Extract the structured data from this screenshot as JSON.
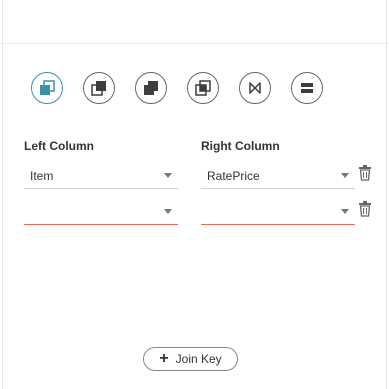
{
  "joinTypes": [
    {
      "name": "left-join",
      "active": true
    },
    {
      "name": "right-join",
      "active": false
    },
    {
      "name": "inner-join",
      "active": false
    },
    {
      "name": "full-join",
      "active": false
    },
    {
      "name": "bowtie-join",
      "active": false
    },
    {
      "name": "union",
      "active": false
    }
  ],
  "headers": {
    "left": "Left Column",
    "right": "Right Column"
  },
  "rows": [
    {
      "left": "Item",
      "right": "RatePrice"
    },
    {
      "left": "",
      "right": ""
    }
  ],
  "joinKey": {
    "label": "Join Key"
  },
  "colors": {
    "accent": "#3b8fa9",
    "error": "#e56a5f",
    "iconDark": "#3d3d3d"
  }
}
